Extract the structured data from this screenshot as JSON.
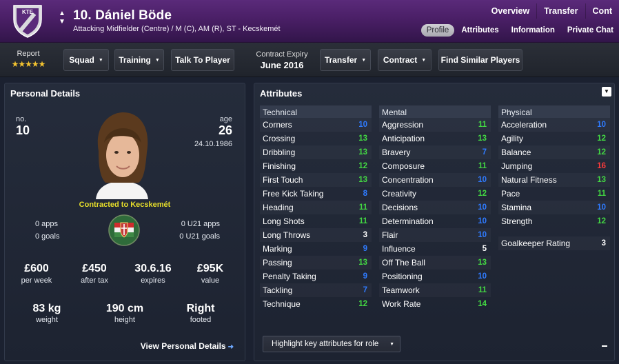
{
  "header": {
    "club_badge_text": "KTE",
    "player_name": "10. Dániel Böde",
    "positions": "Attacking Midfielder (Centre) / M (C), AM (R), ST - Kecskemét",
    "tabs": [
      "Overview",
      "Transfer",
      "Cont"
    ],
    "subtabs": [
      "Profile",
      "Attributes",
      "Information",
      "Private Chat"
    ],
    "active_subtab": "Profile"
  },
  "toolbar": {
    "report_label": "Report",
    "report_stars": 4.5,
    "stars_glyph": "★★★★★",
    "squad": "Squad",
    "training": "Training",
    "talk": "Talk To Player",
    "contract_expiry_label": "Contract Expiry",
    "contract_expiry_value": "June 2016",
    "transfer": "Transfer",
    "contract": "Contract",
    "find_similar": "Find Similar Players"
  },
  "personal": {
    "title": "Personal Details",
    "no_label": "no.",
    "no_value": "10",
    "age_label": "age",
    "age_value": "26",
    "dob": "24.10.1986",
    "contracted": "Contracted to Kecskemét",
    "apps": "0 apps",
    "goals": "0 goals",
    "u21_apps": "0 U21 apps",
    "u21_goals": "0 U21 goals",
    "wage": "£600",
    "wage_label": "per week",
    "after_tax": "£450",
    "after_tax_label": "after tax",
    "expires": "30.6.16",
    "expires_label": "expires",
    "value": "£95K",
    "value_label": "value",
    "weight": "83 kg",
    "weight_label": "weight",
    "height": "190 cm",
    "height_label": "height",
    "foot": "Right",
    "foot_label": "footed",
    "view_link": "View Personal Details"
  },
  "attributes": {
    "title": "Attributes",
    "technical_head": "Technical",
    "mental_head": "Mental",
    "physical_head": "Physical",
    "technical": [
      {
        "name": "Corners",
        "value": "10"
      },
      {
        "name": "Crossing",
        "value": "13"
      },
      {
        "name": "Dribbling",
        "value": "13"
      },
      {
        "name": "Finishing",
        "value": "12"
      },
      {
        "name": "First Touch",
        "value": "13"
      },
      {
        "name": "Free Kick Taking",
        "value": "8"
      },
      {
        "name": "Heading",
        "value": "11"
      },
      {
        "name": "Long Shots",
        "value": "11"
      },
      {
        "name": "Long Throws",
        "value": "3"
      },
      {
        "name": "Marking",
        "value": "9"
      },
      {
        "name": "Passing",
        "value": "13"
      },
      {
        "name": "Penalty Taking",
        "value": "9"
      },
      {
        "name": "Tackling",
        "value": "7"
      },
      {
        "name": "Technique",
        "value": "12"
      }
    ],
    "mental": [
      {
        "name": "Aggression",
        "value": "11"
      },
      {
        "name": "Anticipation",
        "value": "13"
      },
      {
        "name": "Bravery",
        "value": "7"
      },
      {
        "name": "Composure",
        "value": "11"
      },
      {
        "name": "Concentration",
        "value": "10"
      },
      {
        "name": "Creativity",
        "value": "12"
      },
      {
        "name": "Decisions",
        "value": "10"
      },
      {
        "name": "Determination",
        "value": "10"
      },
      {
        "name": "Flair",
        "value": "10"
      },
      {
        "name": "Influence",
        "value": "5"
      },
      {
        "name": "Off The Ball",
        "value": "13"
      },
      {
        "name": "Positioning",
        "value": "10"
      },
      {
        "name": "Teamwork",
        "value": "11"
      },
      {
        "name": "Work Rate",
        "value": "14"
      }
    ],
    "physical": [
      {
        "name": "Acceleration",
        "value": "10"
      },
      {
        "name": "Agility",
        "value": "12"
      },
      {
        "name": "Balance",
        "value": "12"
      },
      {
        "name": "Jumping",
        "value": "16"
      },
      {
        "name": "Natural Fitness",
        "value": "13"
      },
      {
        "name": "Pace",
        "value": "11"
      },
      {
        "name": "Stamina",
        "value": "10"
      },
      {
        "name": "Strength",
        "value": "12"
      }
    ],
    "gk_label": "Goalkeeper Rating",
    "gk_value": "3",
    "highlight_select": "Highlight key attributes for role",
    "colors": {
      "low": "#ffffff",
      "blue": "#2f7bff",
      "green": "#43d943",
      "red": "#ff3b3b"
    }
  }
}
